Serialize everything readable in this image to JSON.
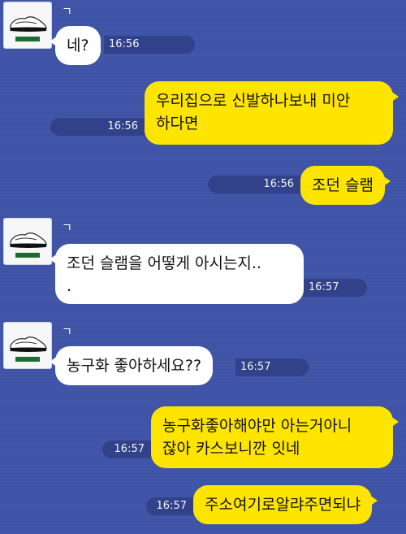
{
  "colors": {
    "background": "#3f53a7",
    "incoming_bubble": "#ffffff",
    "outgoing_bubble": "#fee500",
    "time_pill": "#32428a"
  },
  "sender": {
    "avatar_icon": "sneaker-profile-icon",
    "name_mark": "ㄱ"
  },
  "messages": [
    {
      "direction": "in",
      "lines": [
        "네?"
      ],
      "time": "16:56"
    },
    {
      "direction": "out",
      "lines": [
        "우리집으로 신발하나보내 미안",
        "하다면"
      ],
      "time": "16:56"
    },
    {
      "direction": "out",
      "lines": [
        "조던 슬램"
      ],
      "time": "16:56"
    },
    {
      "direction": "in",
      "lines": [
        "조던 슬램을 어떻게 아시는지..",
        "."
      ],
      "time": "16:57"
    },
    {
      "direction": "in",
      "lines": [
        "농구화 좋아하세요??"
      ],
      "time": "16:57"
    },
    {
      "direction": "out",
      "lines": [
        "농구화좋아해야만 아는거아니",
        "잖아 카스보니깐 잇네"
      ],
      "time": "16:57"
    },
    {
      "direction": "out",
      "lines": [
        "주소여기로알랴주면되냐"
      ],
      "time": "16:57"
    }
  ]
}
